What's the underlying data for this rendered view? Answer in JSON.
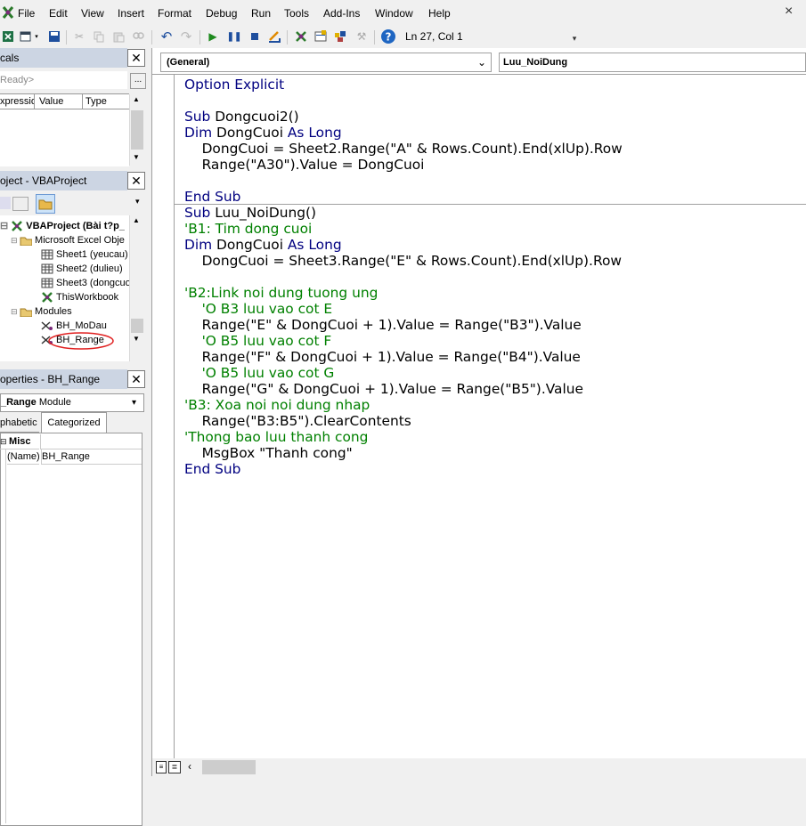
{
  "menu": [
    "File",
    "Edit",
    "View",
    "Insert",
    "Format",
    "Debug",
    "Run",
    "Tools",
    "Add-Ins",
    "Window",
    "Help"
  ],
  "window_close": "×",
  "toolbar": {
    "position_text": "Ln 27, Col 1"
  },
  "locals": {
    "title": "cals",
    "status": "Ready>",
    "ellipsis": "...",
    "columns": [
      "xpressio",
      "Value",
      "Type"
    ]
  },
  "project": {
    "title": "oject - VBAProject",
    "tree": [
      {
        "label": "VBAProject (Bài t?p_",
        "bold": true
      },
      {
        "label": "Microsoft Excel Obje"
      },
      {
        "label": "Sheet1 (yeucau)"
      },
      {
        "label": "Sheet2 (dulieu)"
      },
      {
        "label": "Sheet3 (dongcuo"
      },
      {
        "label": "ThisWorkbook"
      },
      {
        "label": "Modules"
      },
      {
        "label": "BH_MoDau"
      },
      {
        "label": "BH_Range"
      }
    ]
  },
  "properties": {
    "title": "operties - BH_Range",
    "object_name": "_Range",
    "object_type": "Module",
    "tabs": [
      "phabetic",
      "Categorized"
    ],
    "category": "Misc",
    "rows": [
      {
        "name": "(Name)",
        "value": "BH_Range"
      }
    ]
  },
  "code": {
    "object_combo": "(General)",
    "proc_combo": "Luu_NoiDung",
    "colors": {
      "keyword": "#000080",
      "comment": "#008000",
      "text": "#000000"
    },
    "lines": [
      [
        {
          "t": "kw",
          "s": "Option Explicit"
        }
      ],
      [],
      [
        {
          "t": "kw",
          "s": "Sub "
        },
        {
          "t": "n",
          "s": "Dongcuoi2()"
        }
      ],
      [
        {
          "t": "kw",
          "s": "Dim "
        },
        {
          "t": "n",
          "s": "DongCuoi "
        },
        {
          "t": "kw",
          "s": "As Long"
        }
      ],
      [
        {
          "t": "n",
          "s": "    DongCuoi = Sheet2.Range(\"A\" & Rows.Count).End(xlUp).Row"
        }
      ],
      [
        {
          "t": "n",
          "s": "    Range(\"A30\").Value = DongCuoi"
        }
      ],
      [],
      [
        {
          "t": "kw",
          "s": "End Sub"
        }
      ],
      [
        {
          "t": "kw",
          "s": "Sub "
        },
        {
          "t": "n",
          "s": "Luu_NoiDung()"
        }
      ],
      [
        {
          "t": "cm",
          "s": "'B1: Tim dong cuoi"
        }
      ],
      [
        {
          "t": "kw",
          "s": "Dim "
        },
        {
          "t": "n",
          "s": "DongCuoi "
        },
        {
          "t": "kw",
          "s": "As Long"
        }
      ],
      [
        {
          "t": "n",
          "s": "    DongCuoi = Sheet3.Range(\"E\" & Rows.Count).End(xlUp).Row"
        }
      ],
      [],
      [
        {
          "t": "cm",
          "s": "'B2:Link noi dung tuong ung"
        }
      ],
      [
        {
          "t": "cm",
          "s": "    'O B3 luu vao cot E"
        }
      ],
      [
        {
          "t": "n",
          "s": "    Range(\"E\" & DongCuoi + 1).Value = Range(\"B3\").Value"
        }
      ],
      [
        {
          "t": "cm",
          "s": "    'O B5 luu vao cot F"
        }
      ],
      [
        {
          "t": "n",
          "s": "    Range(\"F\" & DongCuoi + 1).Value = Range(\"B4\").Value"
        }
      ],
      [
        {
          "t": "cm",
          "s": "    'O B5 luu vao cot G"
        }
      ],
      [
        {
          "t": "n",
          "s": "    Range(\"G\" & DongCuoi + 1).Value = Range(\"B5\").Value"
        }
      ],
      [
        {
          "t": "cm",
          "s": "'B3: Xoa noi noi dung nhap"
        }
      ],
      [
        {
          "t": "n",
          "s": "    Range(\"B3:B5\").ClearContents"
        }
      ],
      [
        {
          "t": "cm",
          "s": "'Thong bao luu thanh cong"
        }
      ],
      [
        {
          "t": "n",
          "s": "    MsgBox \"Thanh cong\""
        }
      ],
      [
        {
          "t": "kw",
          "s": "End Sub"
        }
      ]
    ]
  }
}
